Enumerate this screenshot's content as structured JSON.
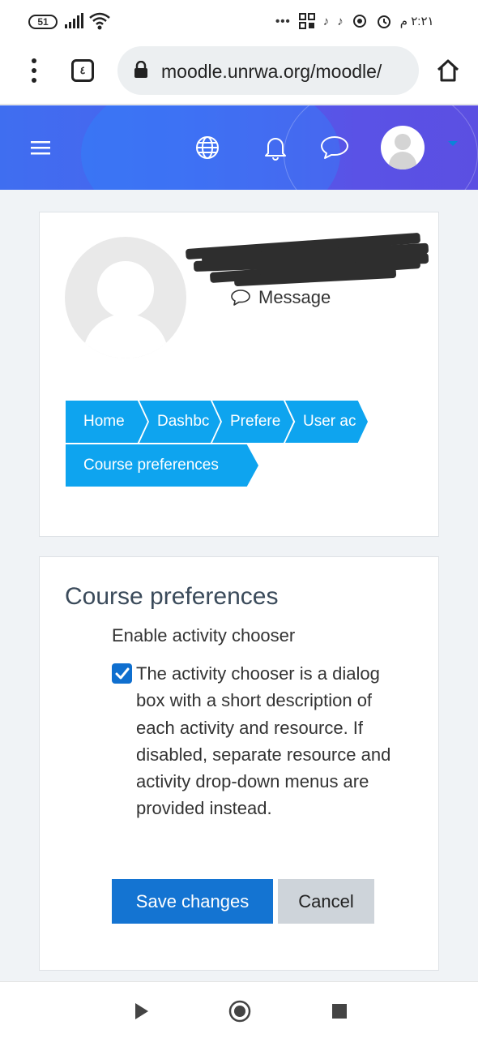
{
  "status_bar": {
    "battery": "51",
    "time": "٢:٢١ م"
  },
  "browser": {
    "tab_count": "٤",
    "url": "moodle.unrwa.org/moodle/"
  },
  "navbar": {
    "icons": [
      "menu-icon",
      "globe-icon",
      "bell-icon",
      "chat-icon"
    ],
    "accent": "#4a63ee"
  },
  "profile": {
    "message_label": "Message"
  },
  "breadcrumb": {
    "items": [
      "Home",
      "Dashbc",
      "Prefere",
      "User ac",
      "Course preferences"
    ],
    "color": "#0ea4ef"
  },
  "course_preferences": {
    "title": "Course preferences",
    "field_label": "Enable activity chooser",
    "checked": true,
    "description": "The activity chooser is a dialog box with a short description of each activity and resource. If disabled, separate resource and activity drop-down menus are provided instead.",
    "save_label": "Save changes",
    "cancel_label": "Cancel"
  }
}
